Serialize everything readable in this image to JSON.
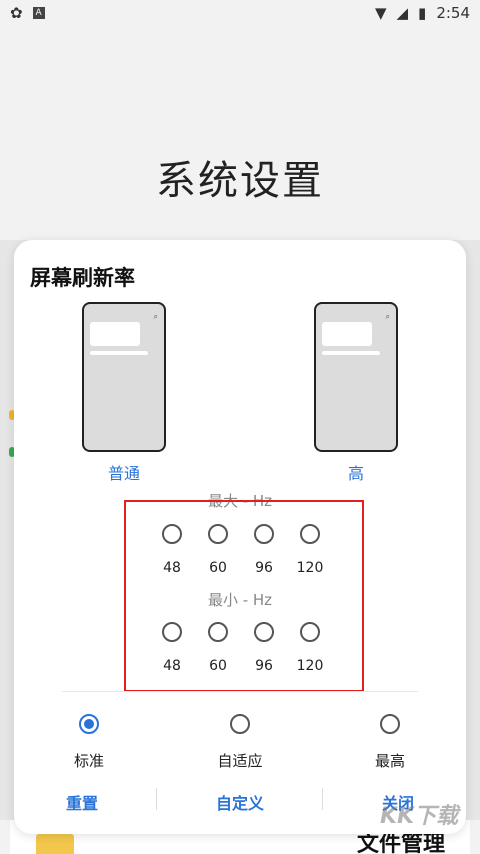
{
  "status_bar": {
    "time": "2:54"
  },
  "background": {
    "title": "系统设置",
    "file_manager_label": "文件管理"
  },
  "dialog": {
    "title": "屏幕刷新率",
    "modes": {
      "left": "普通",
      "right": "高"
    },
    "max_label": "最大 - Hz",
    "min_label": "最小 - Hz",
    "max_values": [
      "48",
      "60",
      "96",
      "120"
    ],
    "min_values": [
      "48",
      "60",
      "96",
      "120"
    ],
    "options": [
      {
        "label": "标准",
        "selected": true
      },
      {
        "label": "自适应",
        "selected": false
      },
      {
        "label": "最高",
        "selected": false
      }
    ],
    "actions": {
      "reset": "重置",
      "custom": "自定义",
      "close": "关闭"
    },
    "accent_color": "#2a73d9",
    "highlight_color": "#e02020"
  },
  "watermark": "KK下载"
}
